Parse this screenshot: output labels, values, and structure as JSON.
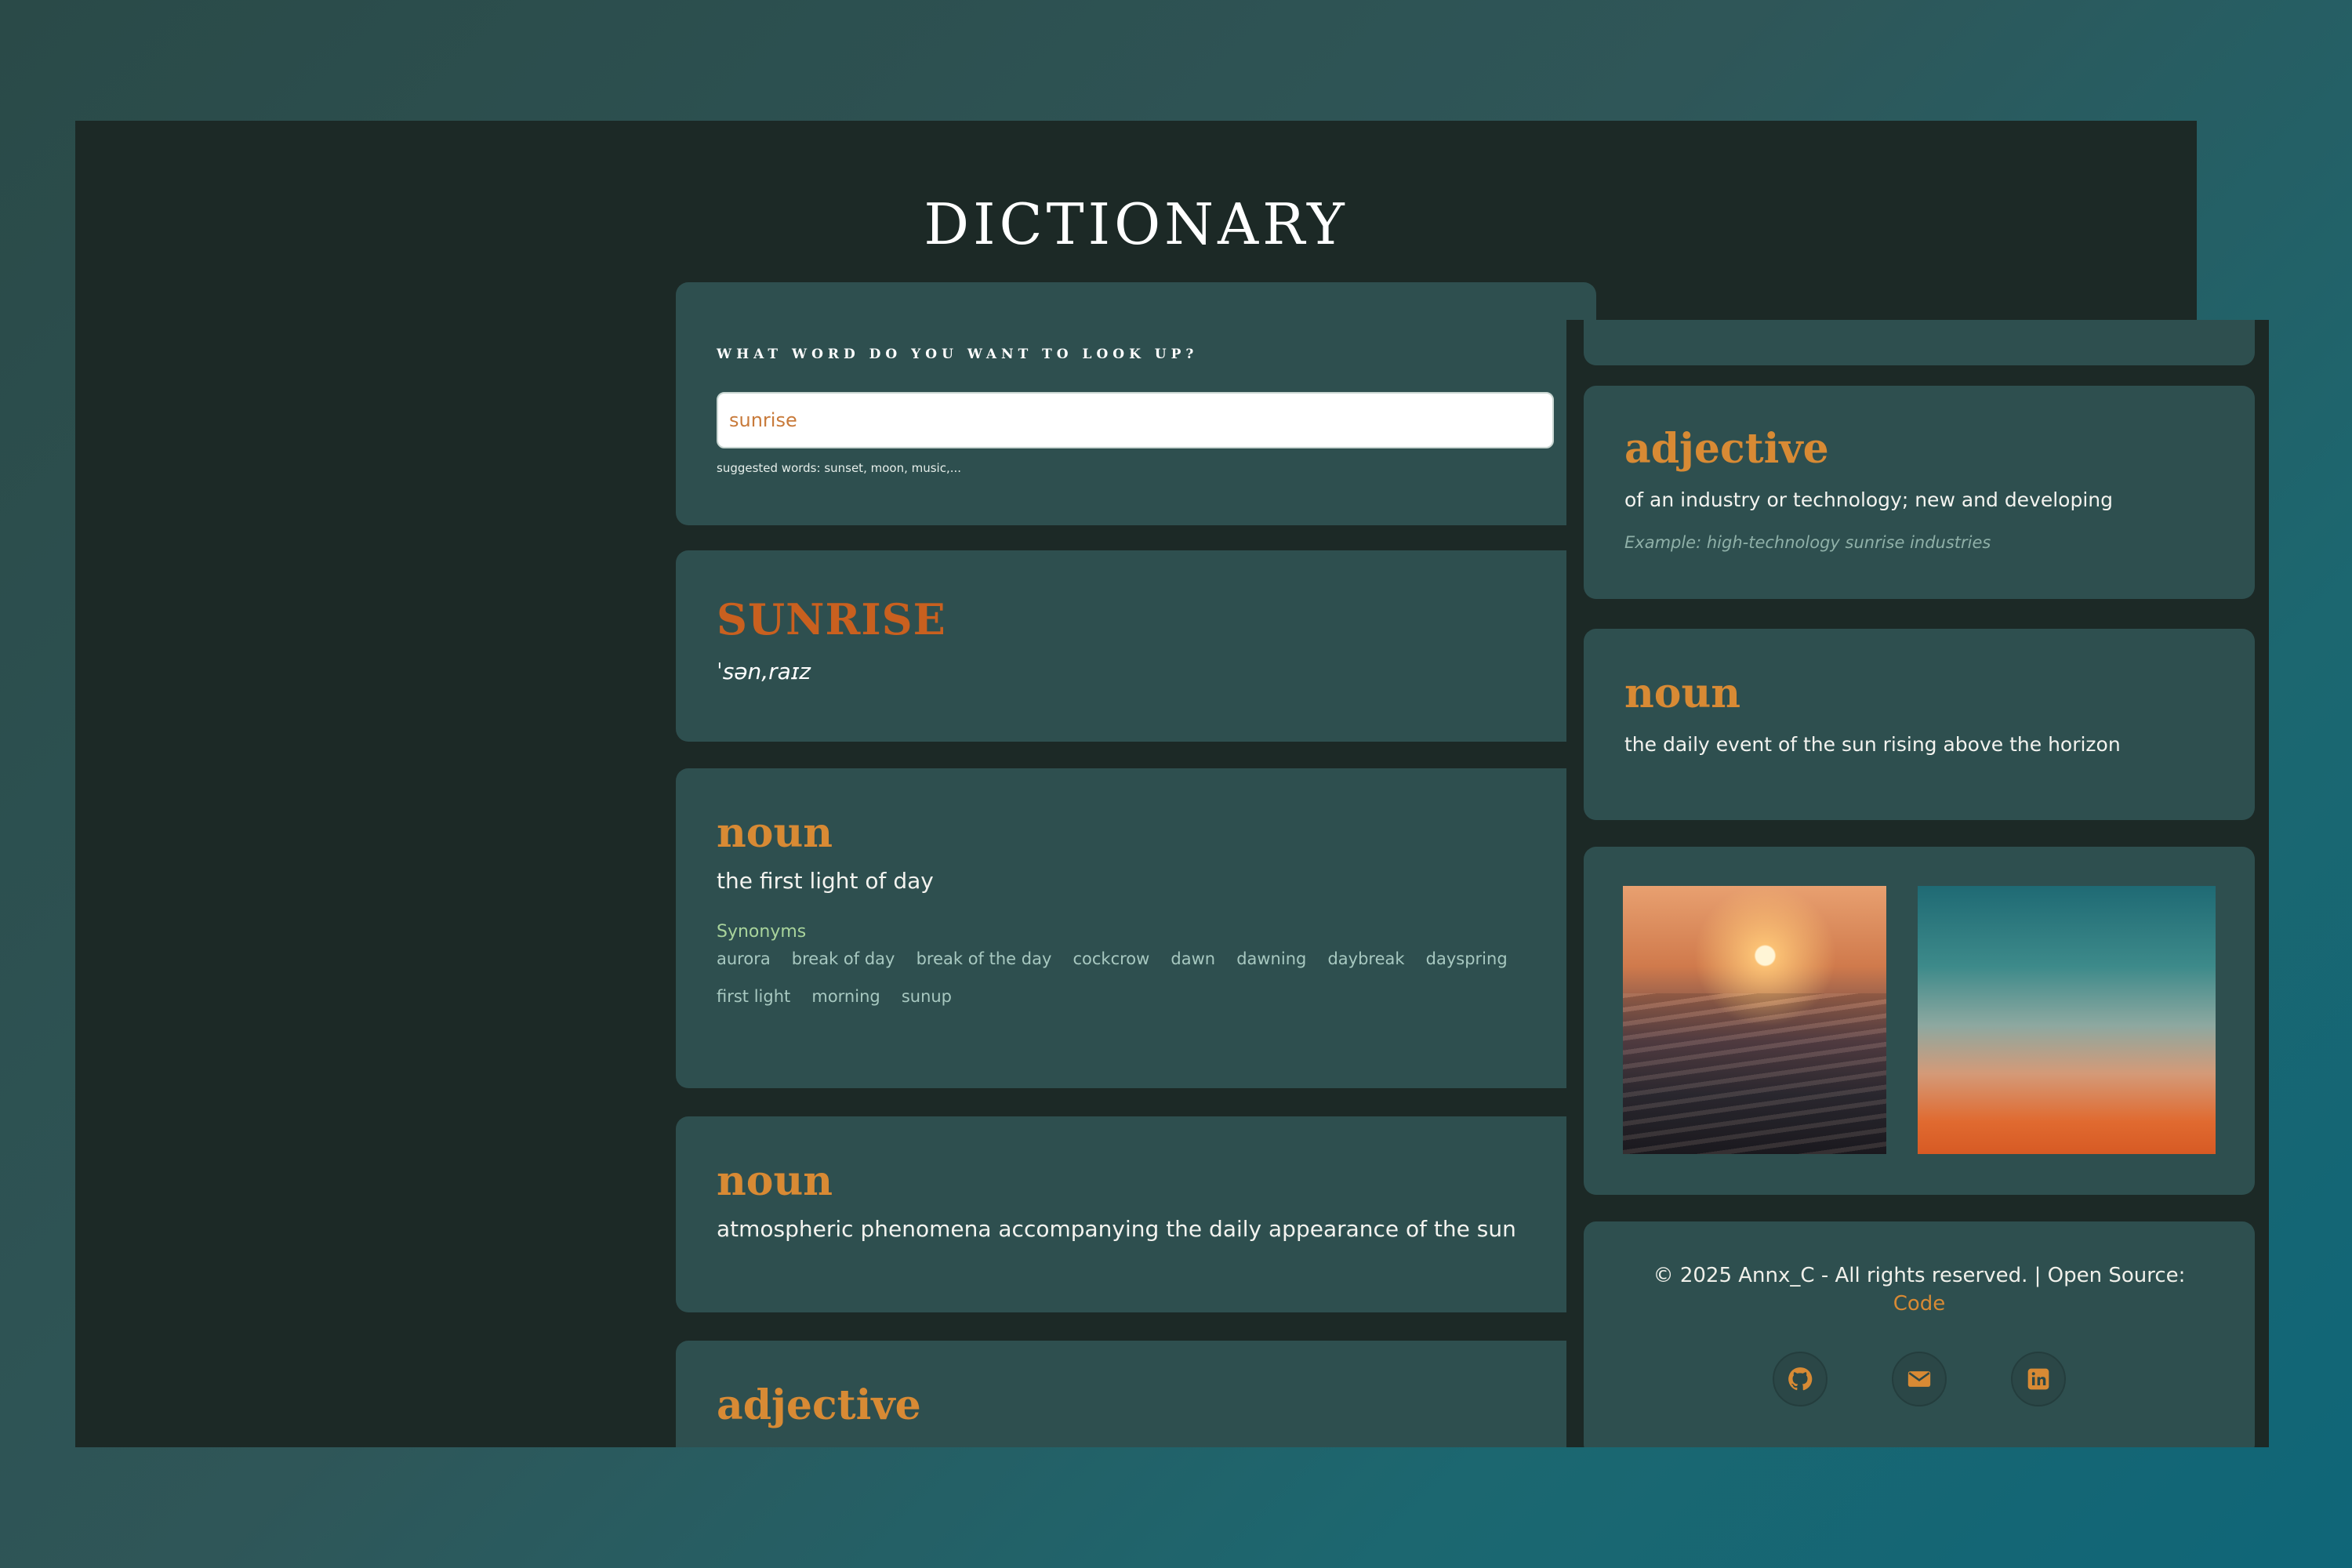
{
  "app": {
    "title": "DICTIONARY"
  },
  "search": {
    "label": "What word do you want to look up?",
    "value": "sunrise",
    "hint": "suggested words: sunset, moon, music,..."
  },
  "word": {
    "text": "SUNRISE",
    "phonetic": "ˈsən,raɪz"
  },
  "meanings": [
    {
      "part_of_speech": "noun",
      "definition": "the first light of day",
      "synonyms_title": "Synonyms",
      "synonyms": [
        "aurora",
        "break of day",
        "break of the day",
        "cockcrow",
        "dawn",
        "dawning",
        "daybreak",
        "dayspring",
        "first light",
        "morning",
        "sunup"
      ]
    },
    {
      "part_of_speech": "noun",
      "definition": "atmospheric phenomena accompanying the daily appearance of the sun"
    },
    {
      "part_of_speech": "adjective"
    }
  ],
  "side": {
    "adjective": {
      "part_of_speech": "adjective",
      "definition": "of an industry or technology; new and developing",
      "example_label": "Example:",
      "example": "high-technology sunrise industries"
    },
    "noun": {
      "part_of_speech": "noun",
      "definition": "the daily event of the sun rising above the horizon"
    },
    "images": [
      "sunrise over ocean waves",
      "orange sky at dawn"
    ]
  },
  "footer": {
    "copyright": "© 2025 Annx_C - All rights reserved. | Open Source:",
    "code_link": "Code",
    "socials": [
      "github-icon",
      "email-icon",
      "linkedin-icon"
    ]
  },
  "colors": {
    "background": "#1c2926",
    "card": "#2e4f4f",
    "accent": "#d88a34",
    "word_accent": "#c9601f"
  }
}
